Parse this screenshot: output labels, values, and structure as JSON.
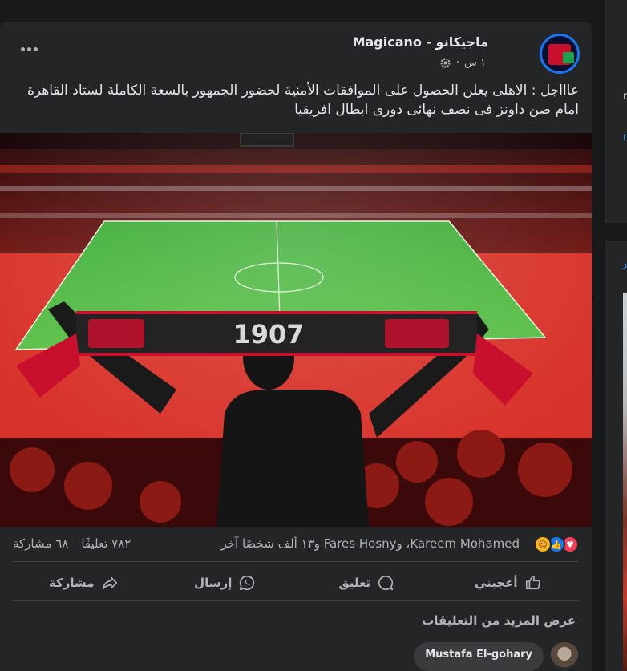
{
  "post": {
    "author": "ماجيكانو - Magicano",
    "time": "١ س",
    "audience_icon": "gear-icon",
    "text": "عاااجل : الاهلى يعلن الحصول  على الموافقات الأمنية لحضور الجمهور بالسعة الكاملة لستاد القاهرة امام صن داونز فى نصف نهائى دورى ابطال افريقيا",
    "image_scarf_text": "1907"
  },
  "reactions": {
    "icons": [
      "love-icon",
      "like-icon",
      "haha-icon"
    ],
    "summary": "Kareem Mohamed، وFares Hosny و١٣ ألف شخصًا آخر",
    "comments_count": "٧٨٢ تعليقًا",
    "shares_count": "٦٨ مشاركة"
  },
  "actions": {
    "like": "أعجبني",
    "comment": "تعليق",
    "send": "إرسال",
    "share": "مشاركة"
  },
  "comments": {
    "view_more": "عرض المزيد من التعليقات",
    "first_commenter": "Mustafa El-gohary"
  },
  "sidebar": {
    "fragment_1": "n",
    "fragment_2": "n",
    "fragment_3": "ر"
  },
  "colors": {
    "background": "#18191a",
    "card": "#242526",
    "text_primary": "#e4e6eb",
    "text_secondary": "#b0b3b8",
    "accent": "#1877f2"
  }
}
